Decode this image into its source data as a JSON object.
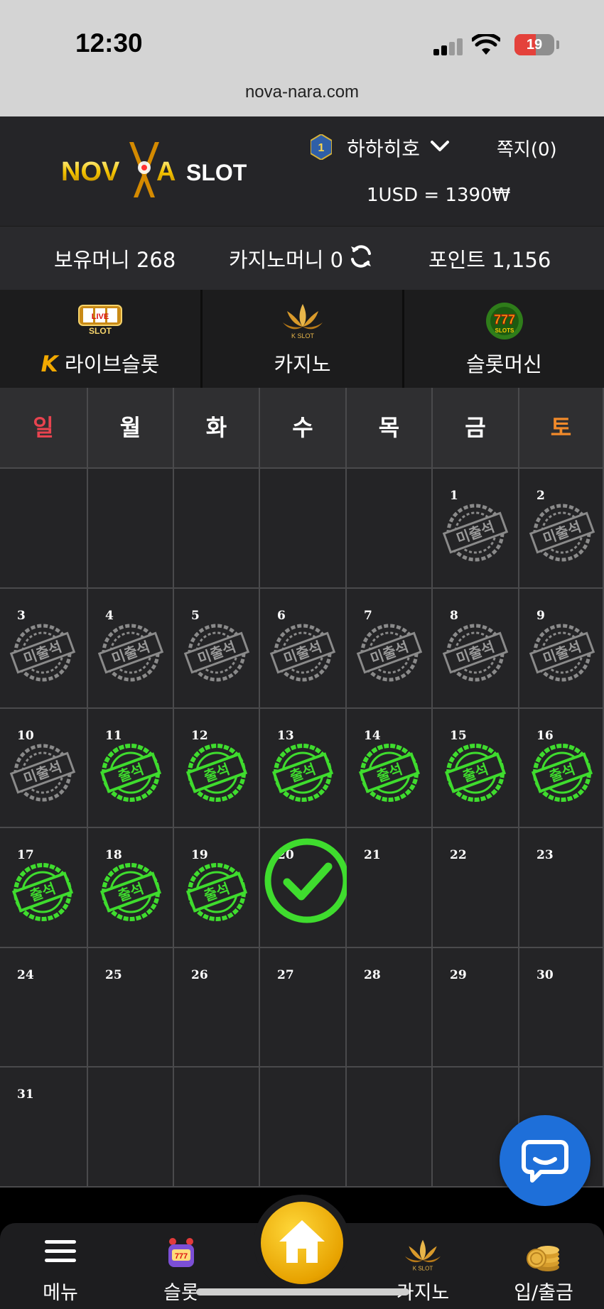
{
  "status_bar": {
    "time": "12:30",
    "battery": "19"
  },
  "browser": {
    "url": "nova-nara.com"
  },
  "header": {
    "logo_text": "NOVA SLOT",
    "user_level": "1",
    "username": "하하히호",
    "memo": "쪽지(0)",
    "exchange_rate": "1USD = 1390₩"
  },
  "balances": {
    "holding": "보유머니 268",
    "casino": "카지노머니 0",
    "points": "포인트 1,156"
  },
  "tabs": [
    {
      "label": "라이브슬롯",
      "icon": "live-slot-icon",
      "badge": "K"
    },
    {
      "label": "카지노",
      "icon": "k-slot-lotus-icon"
    },
    {
      "label": "슬롯머신",
      "icon": "777-slots-icon"
    }
  ],
  "calendar": {
    "weekdays": [
      "일",
      "월",
      "화",
      "수",
      "목",
      "금",
      "토"
    ],
    "weekday_colors": {
      "sun": "#e8434f",
      "sat": "#f18a2a",
      "default": "#ffffff"
    },
    "stamp_absent": "미출석",
    "stamp_present": "출석",
    "days": [
      {
        "d": "",
        "s": ""
      },
      {
        "d": "",
        "s": ""
      },
      {
        "d": "",
        "s": ""
      },
      {
        "d": "",
        "s": ""
      },
      {
        "d": "",
        "s": ""
      },
      {
        "d": "1",
        "s": "absent"
      },
      {
        "d": "2",
        "s": "absent"
      },
      {
        "d": "3",
        "s": "absent"
      },
      {
        "d": "4",
        "s": "absent"
      },
      {
        "d": "5",
        "s": "absent"
      },
      {
        "d": "6",
        "s": "absent"
      },
      {
        "d": "7",
        "s": "absent"
      },
      {
        "d": "8",
        "s": "absent"
      },
      {
        "d": "9",
        "s": "absent"
      },
      {
        "d": "10",
        "s": "absent"
      },
      {
        "d": "11",
        "s": "present"
      },
      {
        "d": "12",
        "s": "present"
      },
      {
        "d": "13",
        "s": "present"
      },
      {
        "d": "14",
        "s": "present"
      },
      {
        "d": "15",
        "s": "present"
      },
      {
        "d": "16",
        "s": "present"
      },
      {
        "d": "17",
        "s": "present"
      },
      {
        "d": "18",
        "s": "present"
      },
      {
        "d": "19",
        "s": "present"
      },
      {
        "d": "20",
        "s": "today"
      },
      {
        "d": "21",
        "s": ""
      },
      {
        "d": "22",
        "s": ""
      },
      {
        "d": "23",
        "s": ""
      },
      {
        "d": "24",
        "s": ""
      },
      {
        "d": "25",
        "s": ""
      },
      {
        "d": "26",
        "s": ""
      },
      {
        "d": "27",
        "s": ""
      },
      {
        "d": "28",
        "s": ""
      },
      {
        "d": "29",
        "s": ""
      },
      {
        "d": "30",
        "s": ""
      },
      {
        "d": "31",
        "s": ""
      },
      {
        "d": "",
        "s": ""
      },
      {
        "d": "",
        "s": ""
      },
      {
        "d": "",
        "s": ""
      },
      {
        "d": "",
        "s": ""
      },
      {
        "d": "",
        "s": ""
      },
      {
        "d": "",
        "s": ""
      }
    ]
  },
  "bottom_nav": [
    {
      "label": "메뉴",
      "icon": "hamburger-icon"
    },
    {
      "label": "슬롯",
      "icon": "slot-machine-icon"
    },
    {
      "label": "",
      "icon": "home-icon"
    },
    {
      "label": "카지노",
      "icon": "k-slot-lotus-icon"
    },
    {
      "label": "입/출금",
      "icon": "coins-icon"
    }
  ],
  "colors": {
    "present_green": "#3fdc2e",
    "absent_gray": "#8a8a8a",
    "accent_yellow": "#f2b400",
    "chat_blue": "#1e6fd9"
  }
}
